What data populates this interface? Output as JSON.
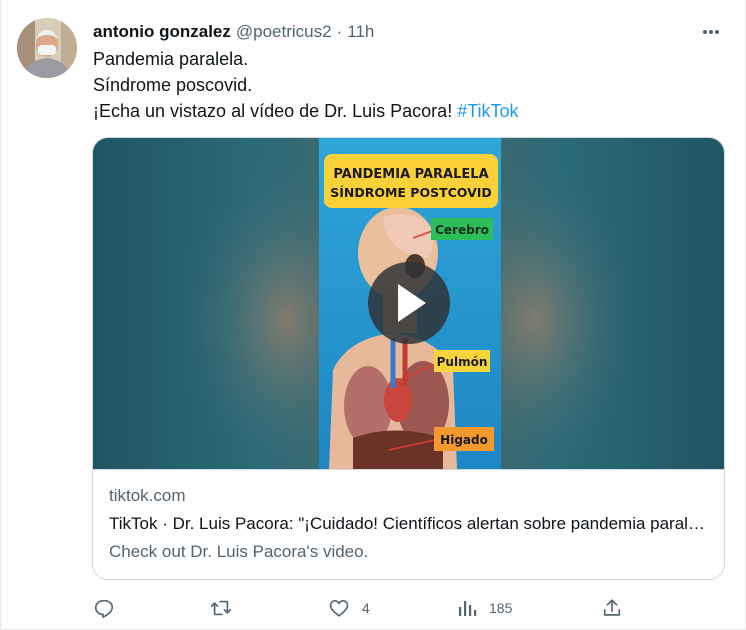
{
  "tweet": {
    "author_name": "antonio gonzalez",
    "handle": "@poetricus2",
    "separator": "·",
    "time": "11h",
    "text_lines": [
      "Pandemia paralela.",
      "Síndrome poscovid."
    ],
    "text_line3_prefix": "¡Echa un vistazo al vídeo de Dr. Luis Pacora! ",
    "hashtag": "#TikTok"
  },
  "card": {
    "banner_line1": "PANDEMIA PARALELA",
    "banner_line2": "SÍNDROME POSTCOVID",
    "labels": [
      "Cerebro",
      "Pulmón",
      "Higado"
    ],
    "domain": "tiktok.com",
    "title": "TikTok · Dr. Luis Pacora: \"¡Cuidado! Científicos alertan sobre pandemia paralela: Síndrome postcovid\"",
    "description": "Check out Dr. Luis Pacora's video."
  },
  "actions": {
    "replies": "",
    "retweets": "",
    "likes": "4",
    "views": "185"
  },
  "icons": [
    "more-icon",
    "play-icon",
    "reply-icon",
    "retweet-icon",
    "like-icon",
    "views-icon",
    "share-icon"
  ],
  "colors": {
    "text": "#0f1419",
    "secondary": "#536471",
    "link": "#1d9bf0",
    "border": "#cfd9de",
    "banner_yellow": "#fbd13a",
    "video_teal": "#245f6c",
    "label_green": "#2dbd5a",
    "label_yellow": "#f7d33c",
    "label_orange": "#f49a2c"
  }
}
